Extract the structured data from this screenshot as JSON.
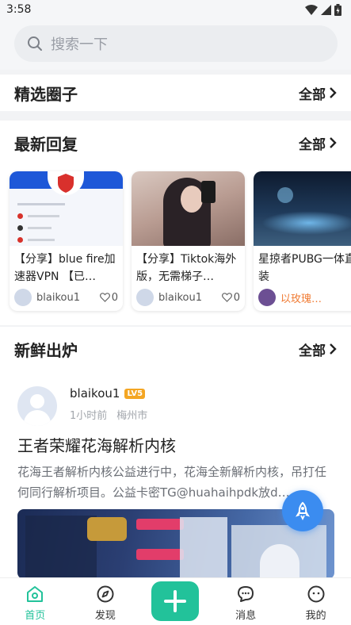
{
  "status_bar": {
    "time": "3:58"
  },
  "search": {
    "placeholder": "搜索一下"
  },
  "sections": {
    "featured": {
      "title": "精选圈子",
      "more": "全部"
    },
    "latest_replies": {
      "title": "最新回复",
      "more": "全部"
    },
    "fresh": {
      "title": "新鲜出炉",
      "more": "全部"
    }
  },
  "reply_cards": [
    {
      "title": "【分享】blue fire加速器VPN 【已…",
      "user": "blaikou1",
      "likes": "0"
    },
    {
      "title": "【分享】Tiktok海外版，无需梯子…",
      "user": "blaikou1",
      "likes": "0"
    },
    {
      "title": "星掠者PUBG一体直装",
      "user": "以玫瑰…",
      "likes": ""
    }
  ],
  "post": {
    "user": "blaikou1",
    "level": "LV5",
    "time": "1小时前",
    "location": "梅州市",
    "title": "王者荣耀花海解析内核",
    "body": "花海王者解析内核公益进行中，花海全新解析内核，吊打任何同行解析项目。公益卡密TG@huahaihpdk放d…"
  },
  "tabs": [
    {
      "label": "首页",
      "icon": "home-icon",
      "active": true
    },
    {
      "label": "发现",
      "icon": "compass-icon",
      "active": false
    },
    {
      "label": "",
      "icon": "plus-icon",
      "active": false
    },
    {
      "label": "消息",
      "icon": "chat-icon",
      "active": false
    },
    {
      "label": "我的",
      "icon": "face-icon",
      "active": false
    }
  ],
  "colors": {
    "accent": "#22c29a",
    "fab": "#3b8cf0",
    "level_badge": "#f4a623",
    "highlight_user": "#f07a32"
  }
}
